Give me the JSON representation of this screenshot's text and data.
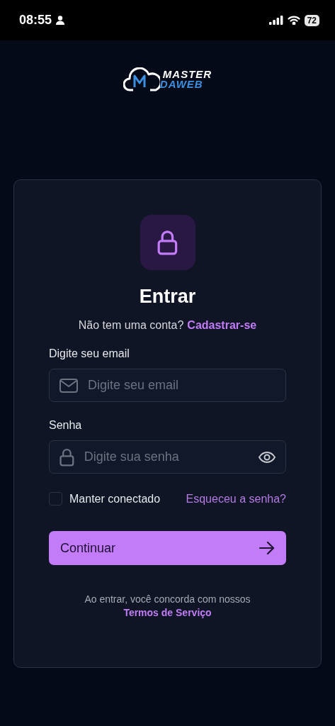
{
  "status_bar": {
    "time": "08:55",
    "battery": "72"
  },
  "logo": {
    "line_1": "MASTER",
    "line_2": "DAWEB"
  },
  "card": {
    "title": "Entrar",
    "prompt": "Não tem uma conta?",
    "signup_link": "Cadastrar-se",
    "fields": [
      {
        "kind": "email",
        "label": "Digite seu email",
        "placeholder": "Digite seu email"
      },
      {
        "kind": "password",
        "label": "Senha",
        "placeholder": "Digite sua senha"
      }
    ],
    "remember": {
      "label": "Manter conectado",
      "checked": false
    },
    "forgot_link": "Esqueceu a senha?",
    "submit": "Continuar",
    "terms_text": "Ao entrar, você concorda com nossos",
    "terms_link": "Termos de Serviço"
  }
}
